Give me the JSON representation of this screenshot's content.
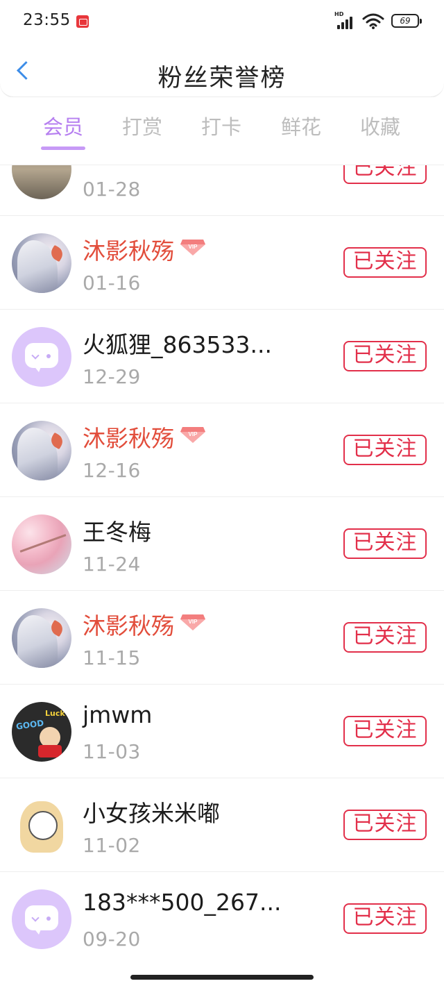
{
  "status_bar": {
    "time": "23:55",
    "network_label": "HD",
    "battery": "69"
  },
  "header": {
    "title": "粉丝荣誉榜"
  },
  "tabs": [
    {
      "label": "会员",
      "active": true
    },
    {
      "label": "打赏",
      "active": false
    },
    {
      "label": "打卡",
      "active": false
    },
    {
      "label": "鲜花",
      "active": false
    },
    {
      "label": "收藏",
      "active": false
    }
  ],
  "list": [
    {
      "name": "",
      "date": "01-28",
      "vip": false,
      "avatar": "photo",
      "follow_label": "已关注"
    },
    {
      "name": "沐影秋殇",
      "date": "01-16",
      "vip": true,
      "avatar": "anime",
      "follow_label": "已关注"
    },
    {
      "name": "火狐狸_863533...",
      "date": "12-29",
      "vip": false,
      "avatar": "default-purple",
      "follow_label": "已关注"
    },
    {
      "name": "沐影秋殇",
      "date": "12-16",
      "vip": true,
      "avatar": "anime",
      "follow_label": "已关注"
    },
    {
      "name": "王冬梅",
      "date": "11-24",
      "vip": false,
      "avatar": "blossom",
      "follow_label": "已关注"
    },
    {
      "name": "沐影秋殇",
      "date": "11-15",
      "vip": true,
      "avatar": "anime",
      "follow_label": "已关注"
    },
    {
      "name": "jmwm",
      "date": "11-03",
      "vip": false,
      "avatar": "cartoon",
      "follow_label": "已关注"
    },
    {
      "name": "小女孩米米嘟",
      "date": "11-02",
      "vip": false,
      "avatar": "girl",
      "follow_label": "已关注"
    },
    {
      "name": "183***500_267...",
      "date": "09-20",
      "vip": false,
      "avatar": "default-purple",
      "follow_label": "已关注"
    }
  ],
  "avatar_text": {
    "good": "GOOD",
    "luck": "Luck"
  },
  "vip_badge_text": "VIP",
  "colors": {
    "accent_tab": "#b67ff0",
    "follow_red": "#e22f4a",
    "vip_name": "#e24d3b",
    "back_blue": "#3d8de8"
  }
}
